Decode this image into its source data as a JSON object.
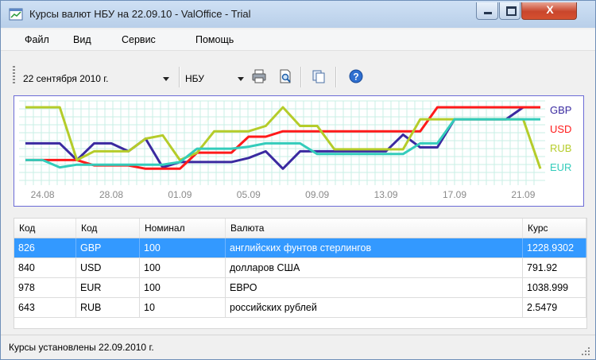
{
  "window": {
    "title": "Курсы валют НБУ на 22.09.10 - ValOffice - Trial",
    "close_glyph": "X"
  },
  "menu": [
    "Файл",
    "Вид",
    "Сервис",
    "Помощь"
  ],
  "toolbar": {
    "date_value": "22 сентября 2010 г.",
    "bank_value": "НБУ",
    "icons": [
      "print-icon",
      "print-preview-icon",
      "copy-icon",
      "help-icon"
    ]
  },
  "chart_data": {
    "type": "line",
    "x": [
      "23.08",
      "24.08",
      "25.08",
      "26.08",
      "27.08",
      "28.08",
      "29.08",
      "30.08",
      "31.08",
      "01.09",
      "02.09",
      "03.09",
      "04.09",
      "05.09",
      "06.09",
      "07.09",
      "08.09",
      "09.09",
      "10.09",
      "11.09",
      "12.09",
      "13.09",
      "14.09",
      "15.09",
      "16.09",
      "17.09",
      "18.09",
      "19.09",
      "20.09",
      "21.09",
      "22.09"
    ],
    "x_tick_labels": [
      "24.08",
      "28.08",
      "01.09",
      "05.09",
      "09.09",
      "13.09",
      "17.09",
      "21.09"
    ],
    "ylim": [
      0,
      100
    ],
    "grid": true,
    "legend": "right",
    "series": [
      {
        "name": "GBP",
        "color": "#3a2aa0",
        "values": [
          46,
          46,
          46,
          21,
          46,
          46,
          34,
          53,
          10,
          18,
          18,
          18,
          18,
          24,
          34,
          8,
          34,
          34,
          34,
          34,
          34,
          34,
          59,
          40,
          40,
          82,
          82,
          82,
          82,
          100,
          100,
          66
        ]
      },
      {
        "name": "USD",
        "color": "#ff1a1a",
        "values": [
          21,
          21,
          21,
          21,
          13,
          13,
          13,
          8,
          8,
          8,
          32,
          32,
          32,
          56,
          56,
          64,
          64,
          64,
          64,
          64,
          64,
          64,
          64,
          64,
          100,
          100,
          100,
          100,
          100,
          100,
          100,
          100
        ]
      },
      {
        "name": "RUB",
        "color": "#b5cc2a",
        "values": [
          100,
          100,
          100,
          21,
          34,
          34,
          34,
          53,
          58,
          21,
          32,
          64,
          64,
          64,
          72,
          100,
          72,
          72,
          37,
          37,
          37,
          37,
          37,
          82,
          82,
          82,
          82,
          82,
          82,
          82,
          8,
          24,
          8
        ]
      },
      {
        "name": "EUR",
        "color": "#33ccbb",
        "values": [
          21,
          21,
          10,
          14,
          14,
          14,
          14,
          14,
          14,
          18,
          38,
          38,
          38,
          41,
          46,
          46,
          46,
          30,
          30,
          30,
          30,
          30,
          30,
          46,
          46,
          82,
          82,
          82,
          82,
          82,
          82,
          82
        ]
      }
    ]
  },
  "table": {
    "headers": [
      "Код",
      "Код",
      "Номинал",
      "Валюта",
      "Курс"
    ],
    "rows": [
      {
        "num": "826",
        "code": "GBP",
        "nominal": "100",
        "name": "английских фунтов стерлингов",
        "rate": "1228.9302",
        "selected": true
      },
      {
        "num": "840",
        "code": "USD",
        "nominal": "100",
        "name": "долларов США",
        "rate": "791.92",
        "selected": false
      },
      {
        "num": "978",
        "code": "EUR",
        "nominal": "100",
        "name": "ЕВРО",
        "rate": "1038.999",
        "selected": false
      },
      {
        "num": "643",
        "code": "RUB",
        "nominal": "10",
        "name": "российских рублей",
        "rate": "2.5479",
        "selected": false
      }
    ]
  },
  "status": {
    "text": "Курсы установлены 22.09.2010 г."
  }
}
